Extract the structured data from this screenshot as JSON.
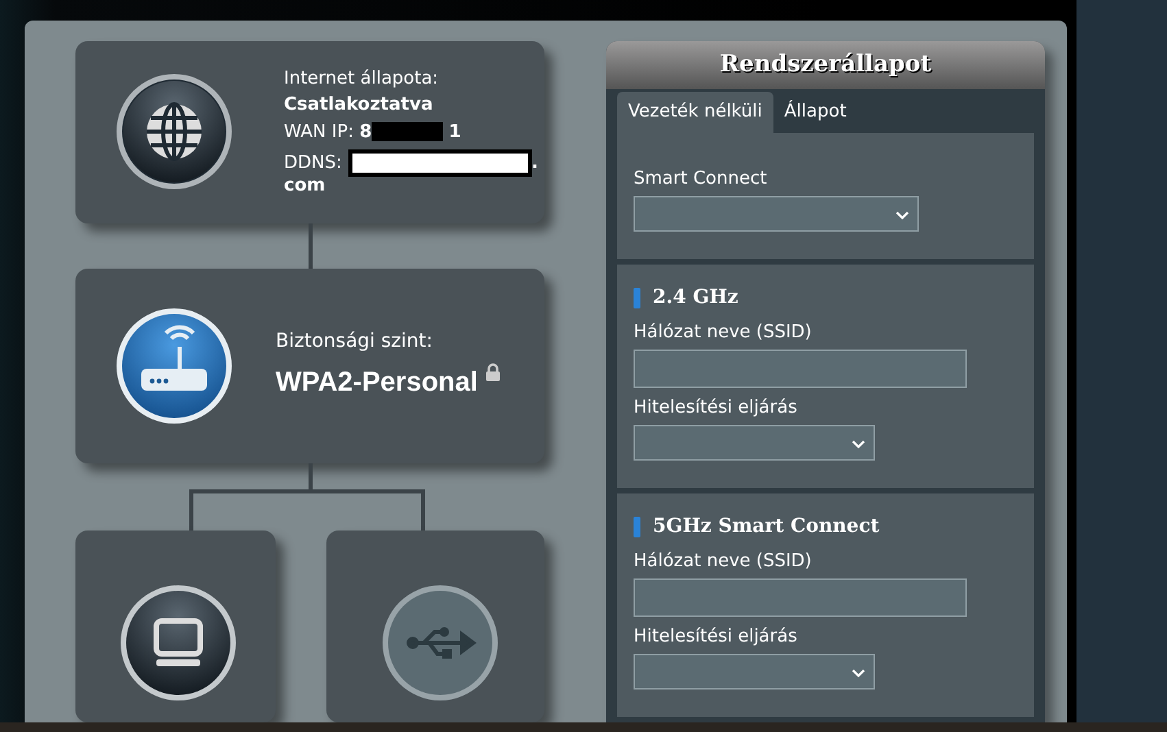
{
  "network_map": {
    "internet": {
      "status_label": "Internet állapota:",
      "status_value": "Csatlakoztatva",
      "wan_ip_label": "WAN IP:",
      "wan_ip_start": "8",
      "wan_ip_end": "1",
      "ddns_label": "DDNS:",
      "ddns_end": ".",
      "ddns_tail": "com"
    },
    "router": {
      "security_label": "Biztonsági szint:",
      "security_value": "WPA2-Personal"
    }
  },
  "panel": {
    "title": "Rendszerállapot",
    "tabs": [
      {
        "label": "Vezeték nélküli",
        "selected": true
      },
      {
        "label": "Állapot",
        "selected": false
      }
    ],
    "sections": [
      {
        "fields": [
          {
            "label": "Smart Connect",
            "kind": "select"
          }
        ]
      },
      {
        "title": "2.4 GHz",
        "fields": [
          {
            "label": "Hálózat neve (SSID)",
            "kind": "text"
          },
          {
            "label": "Hitelesítési eljárás",
            "kind": "select"
          }
        ]
      },
      {
        "title": "5GHz Smart Connect",
        "fields": [
          {
            "label": "Hálózat neve (SSID)",
            "kind": "text"
          },
          {
            "label": "Hitelesítési eljárás",
            "kind": "select"
          }
        ]
      }
    ]
  }
}
